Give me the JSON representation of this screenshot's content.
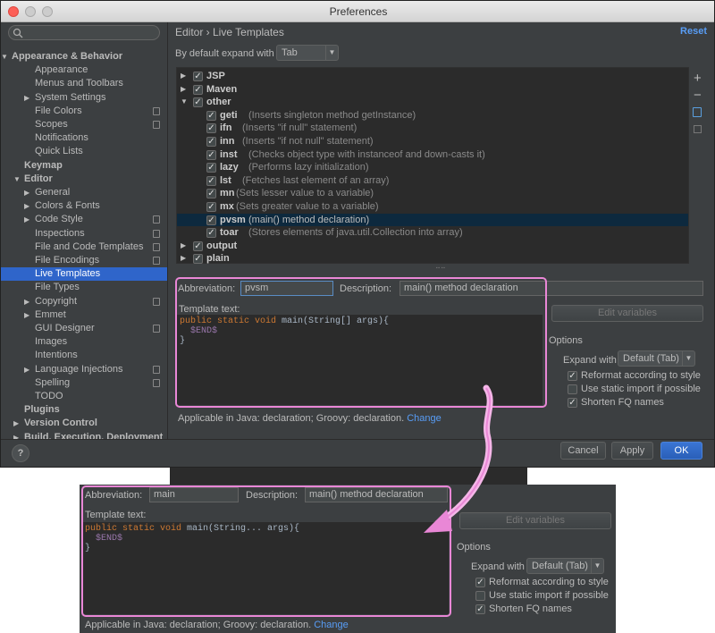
{
  "window": {
    "title": "Preferences"
  },
  "sidebar": {
    "items": [
      {
        "label": "Appearance & Behavior",
        "bold": true,
        "arrow": "▼",
        "indent": 12
      },
      {
        "label": "Appearance",
        "indent": 38
      },
      {
        "label": "Menus and Toolbars",
        "indent": 38
      },
      {
        "label": "System Settings",
        "arrow": "▶",
        "indent": 38
      },
      {
        "label": "File Colors",
        "indent": 38,
        "copy": true
      },
      {
        "label": "Scopes",
        "indent": 38,
        "copy": true
      },
      {
        "label": "Notifications",
        "indent": 38
      },
      {
        "label": "Quick Lists",
        "indent": 38
      },
      {
        "label": "Keymap",
        "bold": true,
        "indent": 26
      },
      {
        "label": "Editor",
        "bold": true,
        "arrow": "▼",
        "indent": 26
      },
      {
        "label": "General",
        "arrow": "▶",
        "indent": 38
      },
      {
        "label": "Colors & Fonts",
        "arrow": "▶",
        "indent": 38
      },
      {
        "label": "Code Style",
        "arrow": "▶",
        "indent": 38,
        "copy": true
      },
      {
        "label": "Inspections",
        "indent": 38,
        "copy": true
      },
      {
        "label": "File and Code Templates",
        "indent": 38,
        "copy": true
      },
      {
        "label": "File Encodings",
        "indent": 38,
        "copy": true
      },
      {
        "label": "Live Templates",
        "indent": 38,
        "selected": true
      },
      {
        "label": "File Types",
        "indent": 38
      },
      {
        "label": "Copyright",
        "arrow": "▶",
        "indent": 38,
        "copy": true
      },
      {
        "label": "Emmet",
        "arrow": "▶",
        "indent": 38
      },
      {
        "label": "GUI Designer",
        "indent": 38,
        "copy": true
      },
      {
        "label": "Images",
        "indent": 38
      },
      {
        "label": "Intentions",
        "indent": 38
      },
      {
        "label": "Language Injections",
        "arrow": "▶",
        "indent": 38,
        "copy": true
      },
      {
        "label": "Spelling",
        "indent": 38,
        "copy": true
      },
      {
        "label": "TODO",
        "indent": 38
      },
      {
        "label": "Plugins",
        "bold": true,
        "indent": 26
      },
      {
        "label": "Version Control",
        "bold": true,
        "arrow": "▶",
        "indent": 26
      },
      {
        "label": "Build, Execution, Deployment",
        "bold": true,
        "arrow": "▶",
        "indent": 26
      }
    ]
  },
  "header": {
    "breadcrumb": "Editor › Live Templates",
    "reset": "Reset"
  },
  "expand": {
    "label": "By default expand with",
    "value": "Tab"
  },
  "templates": [
    {
      "abbr": "JSP",
      "group": true,
      "arrow": "▶"
    },
    {
      "abbr": "Maven",
      "group": true,
      "arrow": "▶"
    },
    {
      "abbr": "other",
      "group": true,
      "arrow": "▼"
    },
    {
      "abbr": "geti",
      "desc": "(Inserts singleton method getInstance)"
    },
    {
      "abbr": "ifn",
      "desc": "(Inserts \"if null\" statement)"
    },
    {
      "abbr": "inn",
      "desc": "(Inserts \"if not null\" statement)"
    },
    {
      "abbr": "inst",
      "desc": "(Checks object type with instanceof and down-casts it)"
    },
    {
      "abbr": "lazy",
      "desc": "(Performs lazy initialization)"
    },
    {
      "abbr": "lst",
      "desc": "(Fetches last element of an array)"
    },
    {
      "abbr": "mn",
      "desc": "(Sets lesser value to a variable)"
    },
    {
      "abbr": "mx",
      "desc": "(Sets greater value to a variable)"
    },
    {
      "abbr": "pvsm",
      "desc": "(main() method declaration)",
      "selected": true
    },
    {
      "abbr": "toar",
      "desc": "(Stores elements of java.util.Collection into array)"
    },
    {
      "abbr": "output",
      "group": true,
      "arrow": "▶"
    },
    {
      "abbr": "plain",
      "group": true,
      "arrow": "▶"
    }
  ],
  "toolbar": {
    "add": "+",
    "remove": "−"
  },
  "editor_top": {
    "abbr_label": "Abbreviation:",
    "abbr_value": "pvsm",
    "desc_label": "Description:",
    "desc_value": "main() method declaration",
    "template_label": "Template text:",
    "code_kw": "public static void",
    "code_rest": " main(String[] args){",
    "code_end": "$END$",
    "code_close": "}",
    "applicable": "Applicable in Java: declaration; Groovy: declaration.",
    "change": "Change"
  },
  "options": {
    "edit_vars": "Edit variables",
    "title": "Options",
    "expand_label": "Expand with",
    "expand_value": "Default (Tab)",
    "reformat": "Reformat according to style",
    "static_import": "Use static import if possible",
    "shorten": "Shorten FQ names"
  },
  "buttons": {
    "help": "?",
    "cancel": "Cancel",
    "apply": "Apply",
    "ok": "OK"
  },
  "editor_bottom": {
    "abbr_label": "Abbreviation:",
    "abbr_value": "main",
    "desc_label": "Description:",
    "desc_value": "main() method declaration",
    "template_label": "Template text:",
    "code_kw": "public static void",
    "code_rest": " main(String... args){",
    "code_end": "$END$",
    "code_close": "}",
    "applicable": "Applicable in Java: declaration; Groovy: declaration.",
    "change": "Change"
  },
  "colors": {
    "accent": "#2f65ca",
    "link": "#589df6",
    "highlight": "#e987d6"
  }
}
